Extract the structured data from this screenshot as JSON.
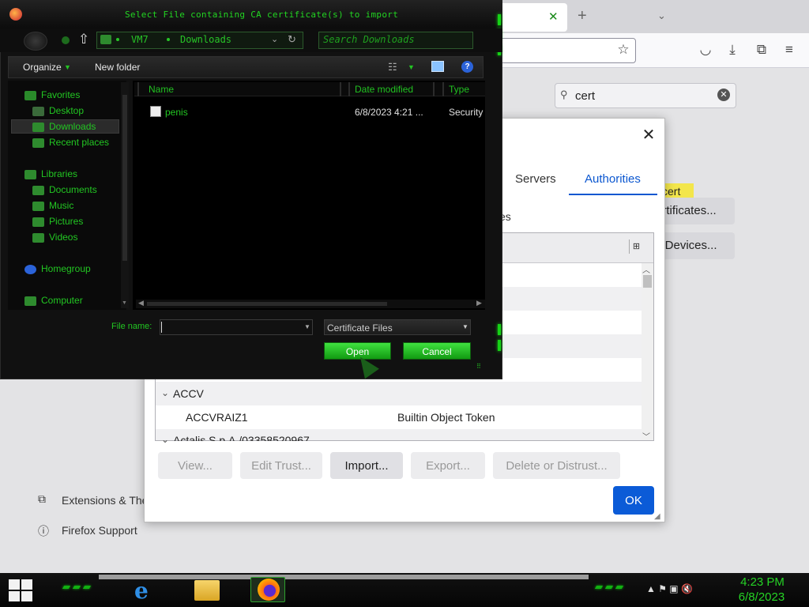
{
  "firefox": {
    "search_value": "cert",
    "highlight_text": "cert",
    "view_certs_button": "ertificates...",
    "security_devices_button": "y Devices...",
    "extensions_label": "Extensions & The",
    "support_label": "Firefox Support"
  },
  "cert_manager": {
    "tabs": [
      {
        "label": "Servers"
      },
      {
        "label": "Authorities"
      }
    ],
    "active_tab": "Authorities",
    "partial_text": "es",
    "rows": [
      {
        "type": "group",
        "label": "ACCV"
      },
      {
        "type": "cert",
        "name": "ACCVRAIZ1",
        "device": "Builtin Object Token"
      },
      {
        "type": "group",
        "label": "Actalis S.p.A./03358520967"
      }
    ],
    "buttons": {
      "view": "View...",
      "edit_trust": "Edit Trust...",
      "import": "Import...",
      "export": "Export...",
      "delete": "Delete or Distrust...",
      "ok": "OK"
    }
  },
  "file_dialog": {
    "title": "Select File containing CA certificate(s) to import",
    "path": [
      "VM7",
      "Downloads"
    ],
    "search_placeholder": "Search Downloads",
    "toolbar": {
      "organize": "Organize",
      "new_folder": "New folder"
    },
    "nav": {
      "favorites": "Favorites",
      "favorites_items": [
        "Desktop",
        "Downloads",
        "Recent places"
      ],
      "selected": "Downloads",
      "libraries": "Libraries",
      "libraries_items": [
        "Documents",
        "Music",
        "Pictures",
        "Videos"
      ],
      "homegroup": "Homegroup",
      "computer": "Computer"
    },
    "columns": [
      "Name",
      "Date modified",
      "Type"
    ],
    "files": [
      {
        "name": "penis",
        "date_modified": "6/8/2023 4:21 ...",
        "type": "Security"
      }
    ],
    "file_name_label": "File name:",
    "file_name_value": "",
    "file_type_filter": "Certificate Files",
    "open_button": "Open",
    "cancel_button": "Cancel"
  },
  "taskbar": {
    "apps": [
      "internet-explorer",
      "file-explorer",
      "firefox"
    ],
    "time": "4:23 PM",
    "date": "6/8/2023"
  }
}
